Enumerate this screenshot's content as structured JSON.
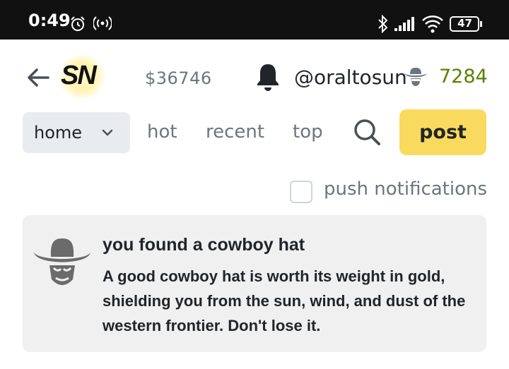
{
  "status_bar": {
    "time": "0:49",
    "battery": "47",
    "icons": [
      "alarm-icon",
      "hotspot-icon",
      "bluetooth-icon",
      "signal-icon",
      "wifi-icon",
      "battery-icon"
    ]
  },
  "header": {
    "logo_text": "SN",
    "price": "$36746",
    "username": "@oraltosun",
    "sats": "7284"
  },
  "nav": {
    "select_label": "home",
    "links": [
      "hot",
      "recent",
      "top"
    ],
    "post_label": "post"
  },
  "push": {
    "label": "push notifications",
    "checked": false
  },
  "card": {
    "title": "you found a cowboy hat",
    "body": "A good cowboy hat is worth its weight in gold, shielding you from the sun, wind, and dust of the western frontier. Don't lose it."
  },
  "colors": {
    "accent": "#fada5e",
    "sats_green": "#5c8001",
    "statusbar": "#111111",
    "card_bg": "#f0f0f0"
  }
}
